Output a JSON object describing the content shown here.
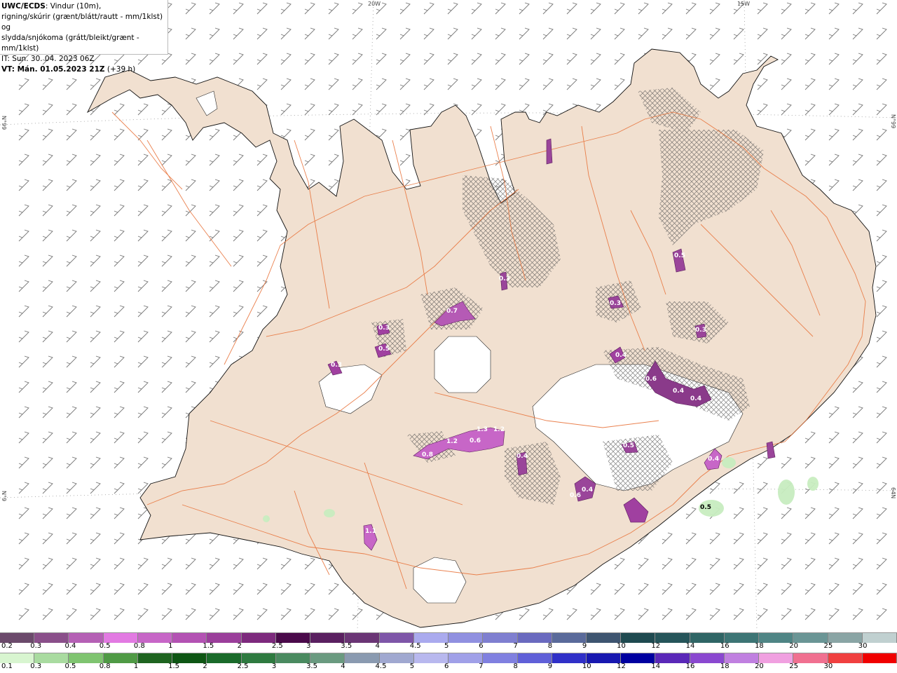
{
  "header": {
    "title_bold": "UWC/ECDS",
    "title_rest": ": Vindur (10m),",
    "line2": "rigning/skúrir (grænt/blátt/rautt - mm/1klst) og",
    "line3": "slydda/snjókoma (grátt/bleikt/grænt - mm/1klst)",
    "it_line": "IT: Sun. 30. 04. 2023 06Z",
    "vt_bold": "VT: Mán. 01.05.2023 21Z",
    "vt_rest": " (+39 h)"
  },
  "grid_labels": {
    "lon_20w": "20W",
    "lon_15w": "15W",
    "lat_66n_left": "N°99",
    "lat_66n_right": "N°99",
    "lat_64n_left": "N°9",
    "lat_64n_right": "64N"
  },
  "map_values": [
    {
      "text": "0.7"
    },
    {
      "text": "0.3"
    },
    {
      "text": "0.5"
    },
    {
      "text": "0.3"
    },
    {
      "text": "1.3"
    },
    {
      "text": "1.2"
    },
    {
      "text": "1.2"
    },
    {
      "text": "0.6"
    },
    {
      "text": "0.8"
    },
    {
      "text": "0.4"
    },
    {
      "text": "0.5"
    },
    {
      "text": "0.4"
    },
    {
      "text": "0.6"
    },
    {
      "text": "0.4"
    },
    {
      "text": "0.4"
    },
    {
      "text": "0.6"
    },
    {
      "text": "0.3"
    },
    {
      "text": "0.3"
    },
    {
      "text": "0.4"
    },
    {
      "text": "0.5"
    },
    {
      "text": "0.5"
    },
    {
      "text": "1.1"
    },
    {
      "text": "0.3"
    },
    {
      "text": "0.4"
    }
  ],
  "legend_snow": {
    "colors": [
      "#6b4a6b",
      "#8a4f8a",
      "#b560b5",
      "#e27ae2",
      "#c766c7",
      "#b352b3",
      "#9a3e9a",
      "#7d2a7d",
      "#4a0a4a",
      "#5a2060",
      "#6a3575",
      "#7e56a8",
      "#aaaaee",
      "#9090e0",
      "#7f7fd0",
      "#6a6abf",
      "#5a6a9a",
      "#3e5570",
      "#1f4a50",
      "#26555a",
      "#2f6565",
      "#3d7575",
      "#4f8585",
      "#6a9595",
      "#8aa5a5",
      "#c0d0d0"
    ],
    "ticks": [
      "0.2",
      "0.3",
      "0.4",
      "0.5",
      "0.8",
      "1",
      "1.5",
      "2",
      "2.5",
      "3",
      "3.5",
      "4",
      "4.5",
      "5",
      "6",
      "7",
      "8",
      "9",
      "10",
      "12",
      "14",
      "16",
      "18",
      "20",
      "25",
      "30"
    ]
  },
  "legend_rain": {
    "colors": [
      "#d8f5d0",
      "#a9dba0",
      "#7fc470",
      "#4f9a45",
      "#1e6420",
      "#0e5614",
      "#1a6a2a",
      "#2e7a40",
      "#4a8a60",
      "#6a9a80",
      "#8a9ab0",
      "#a0a8d0",
      "#b8b8ee",
      "#a0a0e8",
      "#8080e0",
      "#6060d8",
      "#3030c8",
      "#1818b0",
      "#0000a0",
      "#5a28b8",
      "#8a48d0",
      "#c080e0",
      "#f0a0e0",
      "#f07090",
      "#f04040",
      "#f00000"
    ],
    "ticks": [
      "0.1",
      "0.3",
      "0.5",
      "0.8",
      "1",
      "1.5",
      "2",
      "2.5",
      "3",
      "3.5",
      "4",
      "4.5",
      "5",
      "6",
      "7",
      "8",
      "9",
      "10",
      "12",
      "14",
      "16",
      "18",
      "20",
      "25",
      "30"
    ]
  }
}
